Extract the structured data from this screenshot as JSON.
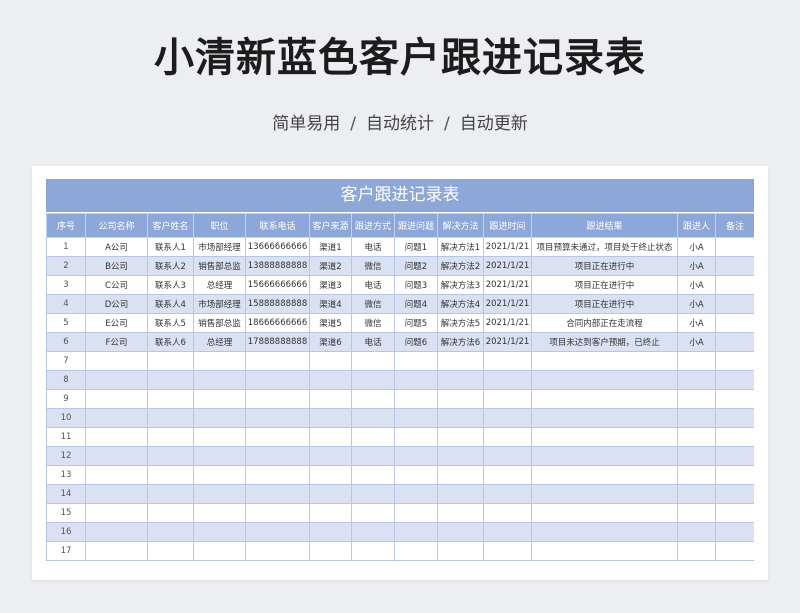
{
  "header": {
    "title": "小清新蓝色客户跟进记录表",
    "features": [
      "简单易用",
      "自动统计",
      "自动更新"
    ],
    "separator": "/"
  },
  "sheet": {
    "title": "客户跟进记录表",
    "columns": [
      "序号",
      "公司名称",
      "客户姓名",
      "职位",
      "联系电话",
      "客户来源",
      "跟进方式",
      "跟进问题",
      "解决方法",
      "跟进时间",
      "跟进结果",
      "跟进人",
      "备注"
    ],
    "rows": [
      [
        "1",
        "A公司",
        "联系人1",
        "市场部经理",
        "13666666666",
        "渠道1",
        "电话",
        "问题1",
        "解决方法1",
        "2021/1/21",
        "项目预算未通过，项目处于终止状态",
        "小A",
        ""
      ],
      [
        "2",
        "B公司",
        "联系人2",
        "销售部总监",
        "13888888888",
        "渠道2",
        "微信",
        "问题2",
        "解决方法2",
        "2021/1/21",
        "项目正在进行中",
        "小A",
        ""
      ],
      [
        "3",
        "C公司",
        "联系人3",
        "总经理",
        "15666666666",
        "渠道3",
        "电话",
        "问题3",
        "解决方法3",
        "2021/1/21",
        "项目正在进行中",
        "小A",
        ""
      ],
      [
        "4",
        "D公司",
        "联系人4",
        "市场部经理",
        "15888888888",
        "渠道4",
        "微信",
        "问题4",
        "解决方法4",
        "2021/1/21",
        "项目正在进行中",
        "小A",
        ""
      ],
      [
        "5",
        "E公司",
        "联系人5",
        "销售部总监",
        "18666666666",
        "渠道5",
        "微信",
        "问题5",
        "解决方法5",
        "2021/1/21",
        "合同内部正在走流程",
        "小A",
        ""
      ],
      [
        "6",
        "F公司",
        "联系人6",
        "总经理",
        "17888888888",
        "渠道6",
        "电话",
        "问题6",
        "解决方法6",
        "2021/1/21",
        "项目未达到客户预期，已终止",
        "小A",
        ""
      ],
      [
        "7",
        "",
        "",
        "",
        "",
        "",
        "",
        "",
        "",
        "",
        "",
        "",
        ""
      ],
      [
        "8",
        "",
        "",
        "",
        "",
        "",
        "",
        "",
        "",
        "",
        "",
        "",
        ""
      ],
      [
        "9",
        "",
        "",
        "",
        "",
        "",
        "",
        "",
        "",
        "",
        "",
        "",
        ""
      ],
      [
        "10",
        "",
        "",
        "",
        "",
        "",
        "",
        "",
        "",
        "",
        "",
        "",
        ""
      ],
      [
        "11",
        "",
        "",
        "",
        "",
        "",
        "",
        "",
        "",
        "",
        "",
        "",
        ""
      ],
      [
        "12",
        "",
        "",
        "",
        "",
        "",
        "",
        "",
        "",
        "",
        "",
        "",
        ""
      ],
      [
        "13",
        "",
        "",
        "",
        "",
        "",
        "",
        "",
        "",
        "",
        "",
        "",
        ""
      ],
      [
        "14",
        "",
        "",
        "",
        "",
        "",
        "",
        "",
        "",
        "",
        "",
        "",
        ""
      ],
      [
        "15",
        "",
        "",
        "",
        "",
        "",
        "",
        "",
        "",
        "",
        "",
        "",
        ""
      ],
      [
        "16",
        "",
        "",
        "",
        "",
        "",
        "",
        "",
        "",
        "",
        "",
        "",
        ""
      ],
      [
        "17",
        "",
        "",
        "",
        "",
        "",
        "",
        "",
        "",
        "",
        "",
        "",
        ""
      ]
    ]
  }
}
